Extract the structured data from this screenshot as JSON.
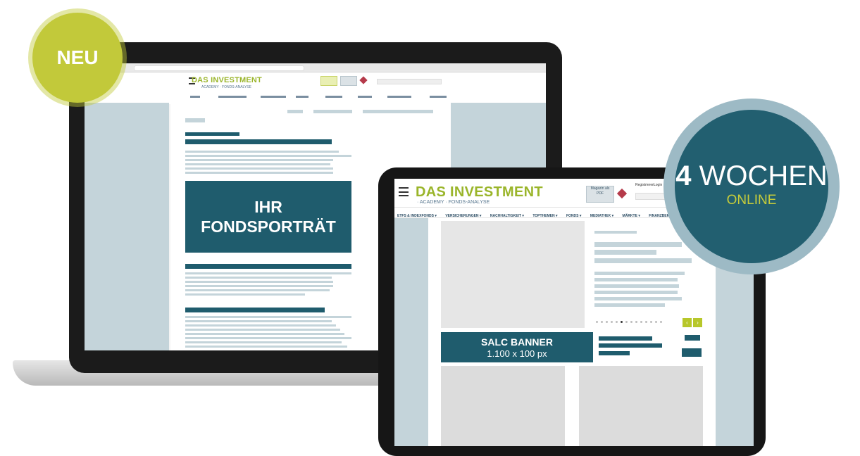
{
  "badges": {
    "neu": "NEU",
    "weeks_number": "4",
    "weeks_label": "WOCHEN",
    "online": "ONLINE"
  },
  "laptop": {
    "site_logo": "DAS INVESTMENT",
    "site_sub": "ACADEMY · FONDS-ANALYSE",
    "hero_line1": "IHR",
    "hero_line2": "FONDSPORTRÄT"
  },
  "tablet": {
    "site_logo": "DAS INVESTMENT",
    "site_sub": "· ACADEMY · FONDS-ANALYSE",
    "magazine_button": "Magazin als PDF",
    "register_link": "Registrieren",
    "login_link": "Login",
    "nav_items": [
      "ETFS & INDEXFONDS ▾",
      "VERSICHERUNGEN ▾",
      "NACHHALTIGKEIT ▾",
      "TOPTHEMEN ▾",
      "FONDS ▾",
      "MEDIATHEK ▾",
      "MÄRKTE ▾",
      "FINANZBERATUNG"
    ],
    "banner_title": "SALC BANNER",
    "banner_size": "1.100 x 100 px",
    "prev_arrow": "‹",
    "next_arrow": "›"
  },
  "colors": {
    "dark_teal": "#1f5c6d",
    "light_blue_grey": "#c4d4da",
    "lime_green": "#c2c93a",
    "logo_green": "#9ab52a"
  }
}
